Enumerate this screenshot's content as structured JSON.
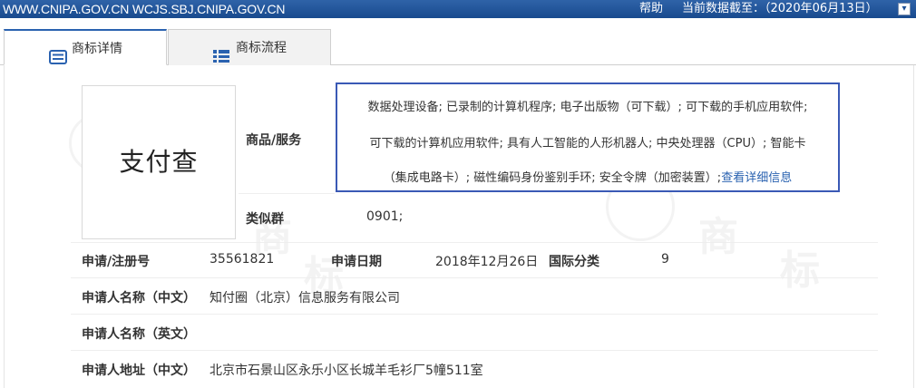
{
  "topbar": {
    "url_text": "WWW.CNIPA.GOV.CN WCJS.SBJ.CNIPA.GOV.CN",
    "help": "帮助",
    "data_date": "当前数据截至：（2020年06月13日）"
  },
  "tabs": [
    {
      "label": "商标详情",
      "icon": "doc-list-icon",
      "active": true
    },
    {
      "label": "商标流程",
      "icon": "grid-list-icon",
      "active": false
    }
  ],
  "trademark": {
    "logo_text": "支付查"
  },
  "goods": {
    "label": "商品/服务",
    "line1": "数据处理设备; 已录制的计算机程序; 电子出版物（可下载）; 可下载的手机应用软件;",
    "line2": "可下载的计算机应用软件; 具有人工智能的人形机器人; 中央处理器（CPU）; 智能卡",
    "line3": "（集成电路卡）; 磁性编码身份鉴别手环; 安全令牌（加密装置）;",
    "more_link": "查看详细信息"
  },
  "similar_group": {
    "label": "类似群",
    "value": "0901;"
  },
  "details": {
    "reg_no_label": "申请/注册号",
    "reg_no": "35561821",
    "app_date_label": "申请日期",
    "app_date": "2018年12月26日",
    "intl_class_label": "国际分类",
    "intl_class": "9",
    "applicant_cn_label": "申请人名称（中文）",
    "applicant_cn": "知付圈（北京）信息服务有限公司",
    "applicant_en_label": "申请人名称（英文）",
    "applicant_en": "",
    "address_cn_label": "申请人地址（中文）",
    "address_cn": "北京市石景山区永乐小区长城羊毛衫厂5幢511室"
  },
  "watermark": {
    "chars": [
      "商",
      "标",
      "商",
      "标"
    ]
  },
  "colors": {
    "topbar": "#184a8e",
    "accent": "#2a62b0",
    "highlight_border": "#3a59b5"
  }
}
